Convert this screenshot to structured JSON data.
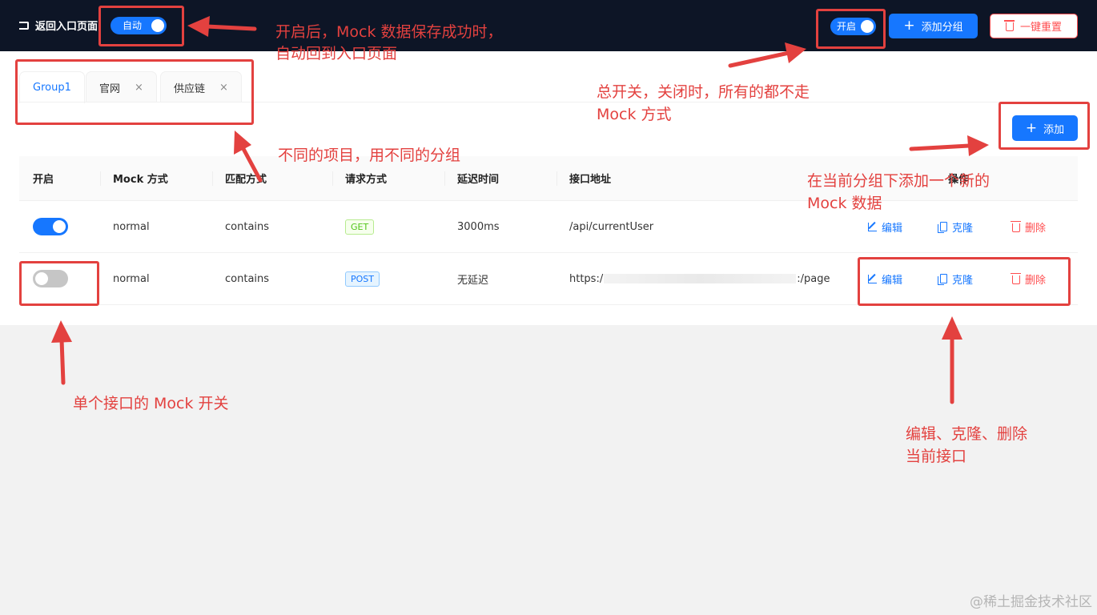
{
  "header": {
    "back_label": "返回入口页面",
    "auto_switch_label": "自动",
    "master_switch_label": "开启",
    "add_group_label": "添加分组",
    "reset_label": "一键重置"
  },
  "tabs": [
    {
      "label": "Group1",
      "active": true
    },
    {
      "label": "官网",
      "active": false,
      "close": "×"
    },
    {
      "label": "供应链",
      "active": false,
      "close": "×"
    }
  ],
  "add_label": "添加",
  "table": {
    "columns": [
      "开启",
      "Mock 方式",
      "匹配方式",
      "请求方式",
      "延迟时间",
      "接口地址",
      "操作"
    ],
    "rows": [
      {
        "enabled": true,
        "mock_mode": "normal",
        "match": "contains",
        "method": "GET",
        "delay": "3000ms",
        "url_prefix": "/api/currentUser",
        "url_suffix": "",
        "edit": "编辑",
        "clone": "克隆",
        "delete": "删除"
      },
      {
        "enabled": false,
        "mock_mode": "normal",
        "match": "contains",
        "method": "POST",
        "delay": "无延迟",
        "url_prefix": "https:/",
        "url_suffix": ":/page",
        "edit": "编辑",
        "clone": "克隆",
        "delete": "删除"
      }
    ]
  },
  "annotations": {
    "auto_note_1": "开启后，Mock 数据保存成功时，",
    "auto_note_2": "自动回到入口页面",
    "master_note_1": "总开关，关闭时，所有的都不走",
    "master_note_2": "Mock 方式",
    "group_note": "不同的项目，用不同的分组",
    "add_note_1": "在当前分组下添加一个新的",
    "add_note_2": "Mock 数据",
    "switch_note": "单个接口的 Mock 开关",
    "action_note_1": "编辑、克隆、删除",
    "action_note_2": "当前接口"
  },
  "watermark": "@稀土掘金技术社区",
  "colors": {
    "primary": "#1677ff",
    "danger": "#ff4d4f",
    "header_bg": "#0d1526",
    "annotation": "#e3413f"
  }
}
